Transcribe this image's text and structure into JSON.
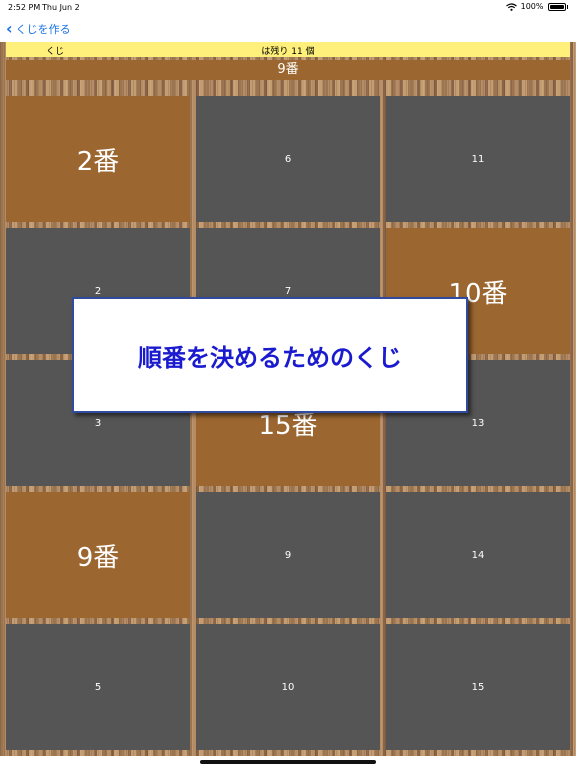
{
  "status": {
    "time": "2:52 PM",
    "date": "Thu Jun 2",
    "battery": "100%"
  },
  "nav": {
    "back_label": "くじを作る"
  },
  "header": {
    "label": "くじ",
    "remaining": "は残り 11 個"
  },
  "current": "9番",
  "cards": [
    {
      "text": "2番",
      "revealed": true
    },
    {
      "text": "6",
      "revealed": false
    },
    {
      "text": "11",
      "revealed": false
    },
    {
      "text": "2",
      "revealed": false
    },
    {
      "text": "7",
      "revealed": false
    },
    {
      "text": "10番",
      "revealed": true
    },
    {
      "text": "3",
      "revealed": false
    },
    {
      "text": "15番",
      "revealed": true
    },
    {
      "text": "13",
      "revealed": false
    },
    {
      "text": "9番",
      "revealed": true
    },
    {
      "text": "9",
      "revealed": false
    },
    {
      "text": "14",
      "revealed": false
    },
    {
      "text": "5",
      "revealed": false
    },
    {
      "text": "10",
      "revealed": false
    },
    {
      "text": "15",
      "revealed": false
    }
  ],
  "dialog": {
    "text": "順番を決めるためのくじ"
  },
  "colors": {
    "revealed": "#9b6630",
    "hidden": "#555555",
    "header": "#fef07a",
    "dialog_text": "#1a1acf",
    "link": "#1a73e8"
  },
  "icons": {
    "back": "chevron-left-icon",
    "wifi": "wifi-icon",
    "battery": "battery-icon"
  }
}
